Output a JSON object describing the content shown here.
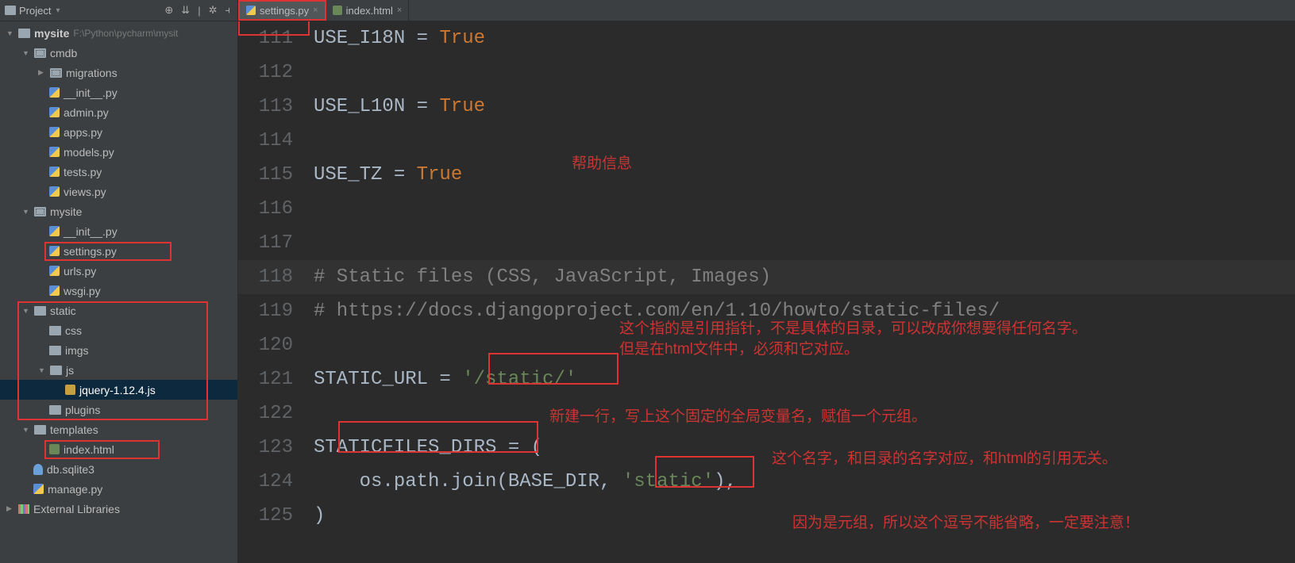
{
  "projectPanel": {
    "title": "Project"
  },
  "tabs": [
    {
      "label": "settings.py",
      "type": "py",
      "active": true,
      "closeable": true
    },
    {
      "label": "index.html",
      "type": "html",
      "active": false,
      "closeable": true
    }
  ],
  "projectRoot": {
    "name": "mysite",
    "path": "F:\\Python\\pycharm\\mysit"
  },
  "tree": {
    "cmdb": "cmdb",
    "migrations": "migrations",
    "cmdb_init": "__init__.py",
    "cmdb_admin": "admin.py",
    "cmdb_apps": "apps.py",
    "cmdb_models": "models.py",
    "cmdb_tests": "tests.py",
    "cmdb_views": "views.py",
    "mysite_pkg": "mysite",
    "mysite_init": "__init__.py",
    "mysite_settings": "settings.py",
    "mysite_urls": "urls.py",
    "mysite_wsgi": "wsgi.py",
    "static": "static",
    "css": "css",
    "imgs": "imgs",
    "js": "js",
    "jquery": "jquery-1.12.4.js",
    "plugins": "plugins",
    "templates": "templates",
    "index_html": "index.html",
    "db": "db.sqlite3",
    "manage": "manage.py",
    "ext_libs": "External Libraries"
  },
  "code": {
    "l111": {
      "a": "USE_I18N = ",
      "b": "True"
    },
    "l113": {
      "a": "USE_L10N = ",
      "b": "True"
    },
    "l115": {
      "a": "USE_TZ = ",
      "b": "True"
    },
    "l118": "# Static files (CSS, JavaScript, Images)",
    "l119": "# https://docs.djangoproject.com/en/1.10/howto/static-files/",
    "l121": {
      "a": "STATIC_URL = ",
      "b": "'/static/'"
    },
    "l123": "STATICFILES_DIRS = (",
    "l124": {
      "a": "    os.path.join(BASE_DIR, ",
      "b": "'static'",
      "c": "),"
    },
    "l125": ")"
  },
  "lineNums": [
    "111",
    "112",
    "113",
    "114",
    "115",
    "116",
    "117",
    "118",
    "119",
    "120",
    "121",
    "122",
    "123",
    "124",
    "125"
  ],
  "annotations": {
    "help": "帮助信息",
    "ptr1": "这个指的是引用指针，不是具体的目录，可以改成你想要得任何名字。",
    "ptr2": "但是在html文件中，必须和它对应。",
    "newline": "新建一行，写上这个固定的全局变量名，赋值一个元组。",
    "name_match": "这个名字，和目录的名字对应，和html的引用无关。",
    "tuple_comma": "因为是元组，所以这个逗号不能省略，一定要注意！"
  }
}
